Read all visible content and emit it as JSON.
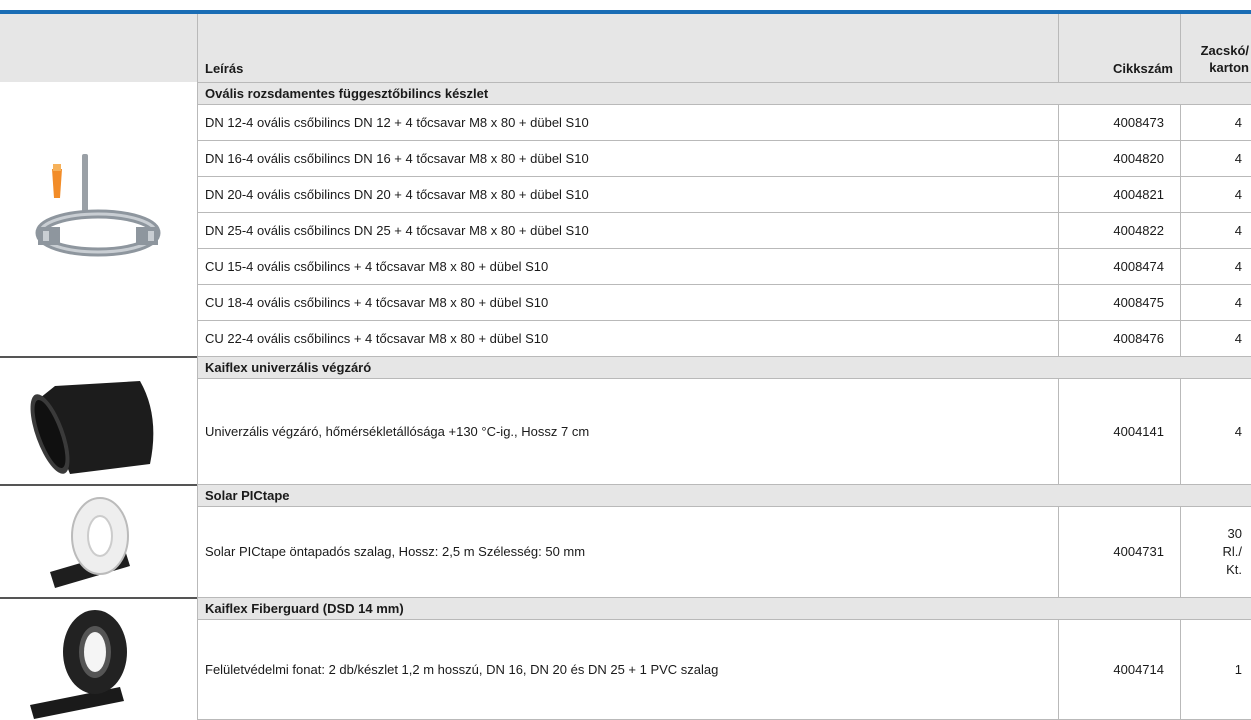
{
  "table": {
    "headers": {
      "description": "Leírás",
      "article_no": "Cikkszám",
      "pack_line1": "Zacskó/",
      "pack_line2": "karton"
    },
    "groups": [
      {
        "title": "Ovális rozsdamentes függesztőbilincs készlet",
        "image": "oval-pipe-clamp",
        "rows": [
          {
            "desc": "DN 12-4 ovális csőbilincs DN 12 + 4 tőcsavar M8 x 80 + dübel S10",
            "article": "4008473",
            "pack": "4"
          },
          {
            "desc": "DN 16-4 ovális csőbilincs DN 16 + 4 tőcsavar M8 x 80 + dübel S10",
            "article": "4004820",
            "pack": "4"
          },
          {
            "desc": "DN 20-4 ovális csőbilincs DN 20 + 4 tőcsavar M8 x 80 + dübel S10",
            "article": "4004821",
            "pack": "4"
          },
          {
            "desc": "DN 25-4 ovális csőbilincs DN 25 + 4 tőcsavar M8 x 80 + dübel S10",
            "article": "4004822",
            "pack": "4"
          },
          {
            "desc": "CU 15-4 ovális csőbilincs + 4 tőcsavar M8 x 80 + dübel S10",
            "article": "4008474",
            "pack": "4"
          },
          {
            "desc": "CU 18-4 ovális csőbilincs + 4 tőcsavar M8 x 80 + dübel S10",
            "article": "4008475",
            "pack": "4"
          },
          {
            "desc": "CU 22-4 ovális csőbilincs + 4 tőcsavar M8 x 80 + dübel S10",
            "article": "4008476",
            "pack": "4"
          }
        ]
      },
      {
        "title": "Kaiflex univerzális végzáró",
        "image": "black-end-cap",
        "rows": [
          {
            "desc": "Univerzális végzáró, hőmérsékletállósága +130 °C-ig., Hossz 7 cm",
            "article": "4004141",
            "pack": "4"
          }
        ]
      },
      {
        "title": "Solar PICtape",
        "image": "white-tape-roll",
        "rows": [
          {
            "desc": "Solar PICtape öntapadós szalag, Hossz: 2,5 m Szélesség: 50 mm",
            "article": "4004731",
            "pack_lines": [
              "30",
              "Rl./",
              "Kt."
            ]
          }
        ]
      },
      {
        "title": "Kaiflex Fiberguard (DSD 14 mm)",
        "image": "black-fiberguard-roll",
        "rows": [
          {
            "desc": "Felületvédelmi fonat: 2 db/készlet 1,2 m hosszú, DN 16, DN 20 és DN 25 + 1 PVC szalag",
            "article": "4004714",
            "pack": "1"
          }
        ]
      }
    ]
  },
  "colors": {
    "accent": "#1a6db5",
    "header_bg": "#e6e6e6",
    "border": "#b9b9b9"
  }
}
